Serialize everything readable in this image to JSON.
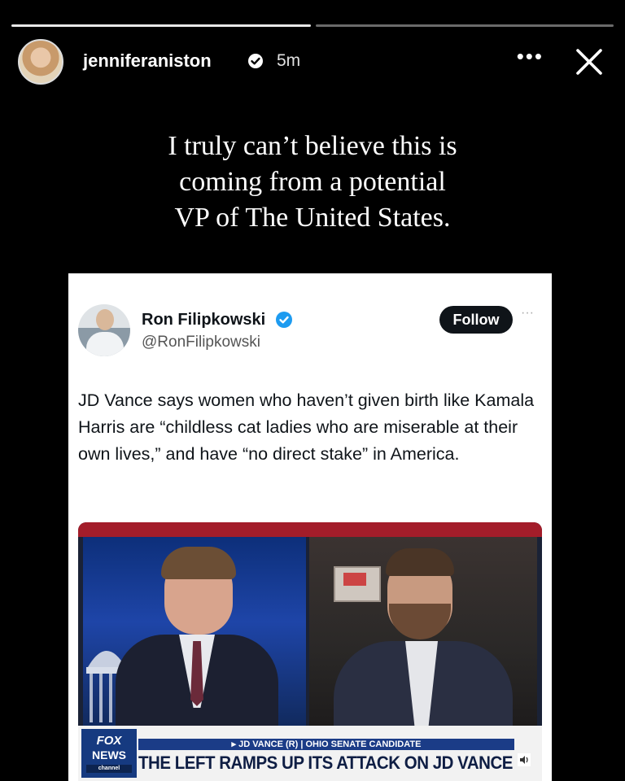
{
  "story": {
    "progress": [
      1.0,
      0.0
    ],
    "username": "jenniferaniston",
    "time": "5m",
    "more_glyph": "•••",
    "close_icon": "close-icon",
    "caption_lines": [
      "I truly can’t believe this is",
      "coming from a potential",
      "VP of The United States."
    ]
  },
  "tweet": {
    "author_name": "Ron Filipkowski",
    "handle": "@RonFilipkowski",
    "follow_label": "Follow",
    "more_glyph": "···",
    "text": "JD Vance says women who haven’t given birth like Kamala Harris are “childless cat ladies who are miserable at their own lives,” and have “no direct stake” in America."
  },
  "video": {
    "logo_top": "FOX",
    "logo_bottom": "NEWS",
    "logo_channel": "channel",
    "ticker_top": "▸ JD VANCE (R) | OHIO SENATE CANDIDATE",
    "ticker_main": "THE LEFT RAMPS UP ITS ATTACK ON JD VANCE",
    "colors": {
      "fox_blue": "#163a80",
      "banner_red": "#a31d2a"
    }
  }
}
